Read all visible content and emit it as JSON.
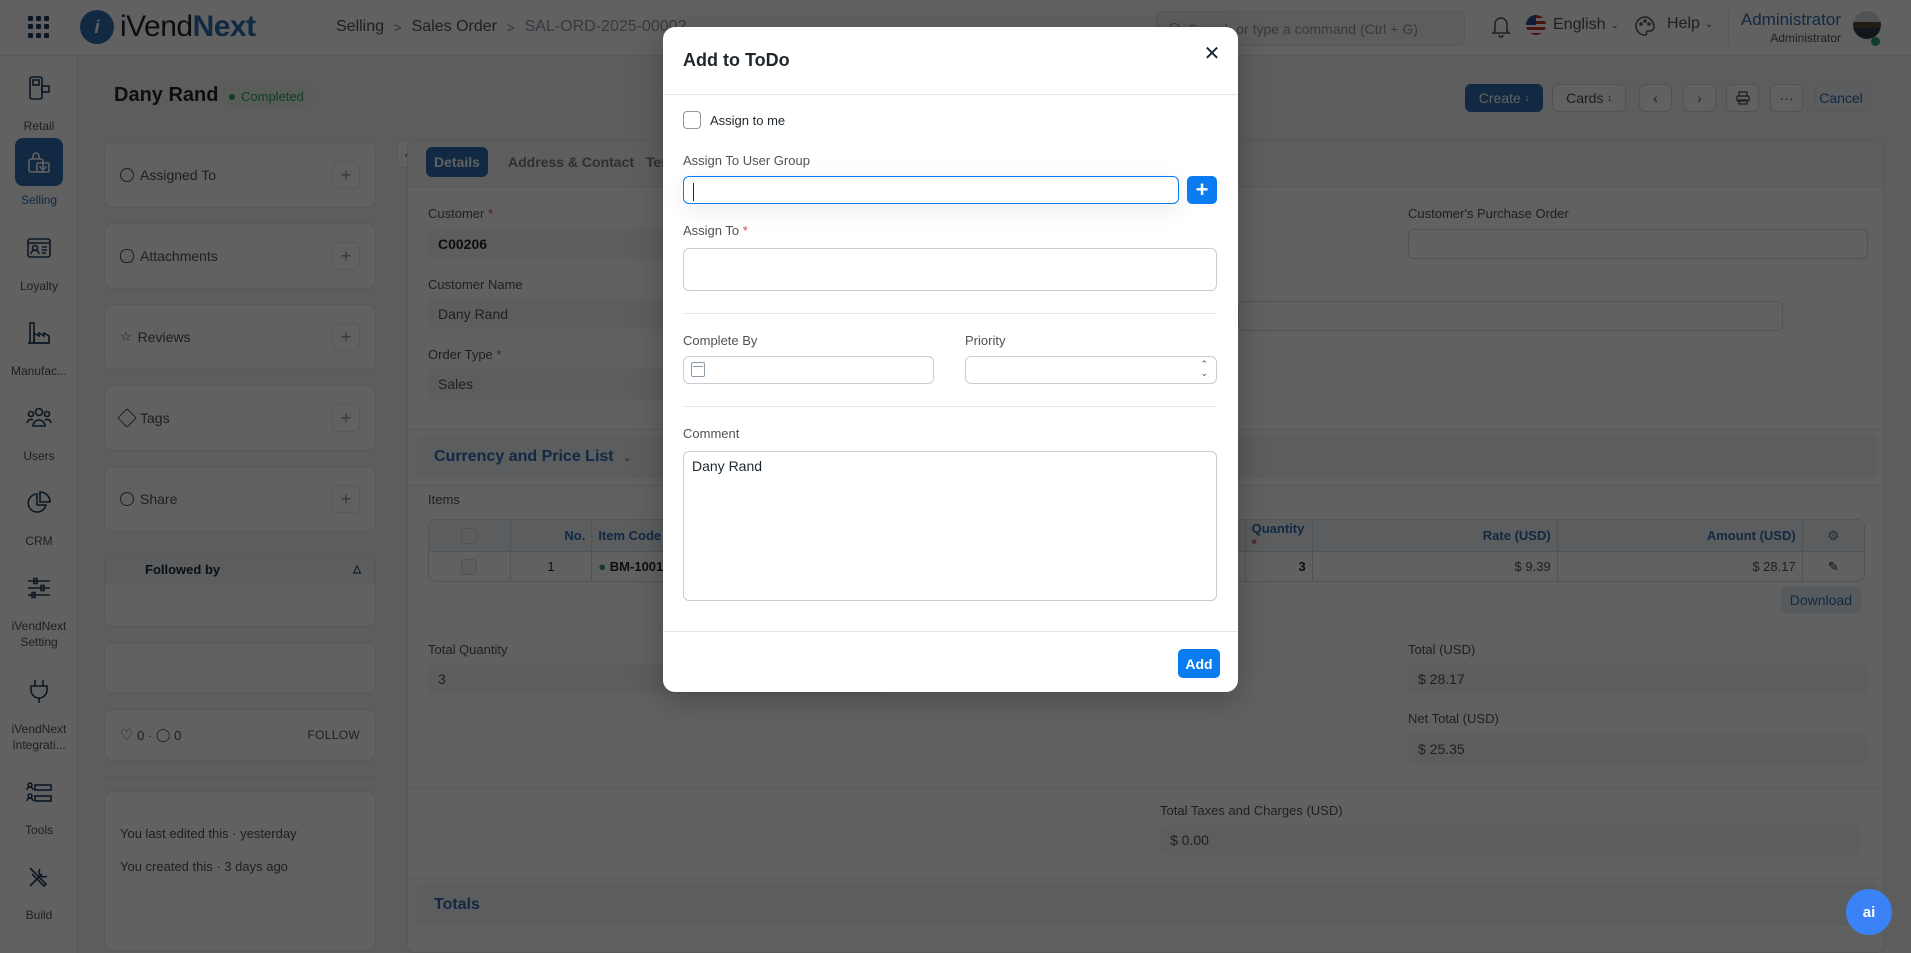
{
  "topbar": {
    "brand_prefix": "iVend",
    "brand_suffix": "Next",
    "breadcrumb": [
      "Selling",
      "Sales Order",
      "SAL-ORD-2025-00002"
    ],
    "search_placeholder": "Search or type a command (Ctrl + G)",
    "language": "English",
    "help_label": "Help",
    "user_name": "Administrator",
    "user_role": "Administrator"
  },
  "rail": {
    "items": [
      {
        "label": "Retail",
        "icon": "pos-terminal-icon"
      },
      {
        "label": "Selling",
        "icon": "shopping-bag-icon",
        "active": true
      },
      {
        "label": "Loyalty",
        "icon": "id-card-icon"
      },
      {
        "label": "Manufac...",
        "icon": "factory-icon"
      },
      {
        "label": "Users",
        "icon": "users-icon"
      },
      {
        "label": "CRM",
        "icon": "pie-chart-icon"
      },
      {
        "label": "iVendNext Setting",
        "icon": "sliders-icon"
      },
      {
        "label": "iVendNext Integrati...",
        "icon": "plug-icon"
      },
      {
        "label": "Tools",
        "icon": "tools-list-icon"
      },
      {
        "label": "Build",
        "icon": "wrench-screwdriver-icon"
      }
    ]
  },
  "header": {
    "title": "Dany Rand",
    "status": "Completed",
    "create_label": "Create",
    "cards_label": "Cards",
    "cancel_label": "Cancel",
    "more_label": "···"
  },
  "sidebar": {
    "cards": [
      {
        "label": "Assigned To"
      },
      {
        "label": "Attachments"
      },
      {
        "label": "Reviews"
      },
      {
        "label": "Tags"
      },
      {
        "label": "Share"
      }
    ],
    "followed_by": "Followed by",
    "likes": "0",
    "comments": "0",
    "follow_label": "FOLLOW",
    "activity": [
      "You last edited this · yesterday",
      "You created this · 3 days ago"
    ]
  },
  "form": {
    "tabs": [
      "Details",
      "Address & Contact",
      "Terms"
    ],
    "customer_label": "Customer",
    "customer_value": "C00206",
    "customer_name_label": "Customer Name",
    "customer_name_value": "Dany Rand",
    "order_type_label": "Order Type",
    "order_type_value": "Sales",
    "purchase_order_label": "Customer's Purchase Order",
    "currency_section": "Currency and Price List",
    "items_label": "Items",
    "items_columns": [
      "No.",
      "Item Code",
      "Quantity",
      "Rate (USD)",
      "Amount (USD)"
    ],
    "items_rows": [
      {
        "no": "1",
        "item_code": "BM-1001",
        "quantity": "3",
        "rate": "$ 9.39",
        "amount": "$ 28.17"
      }
    ],
    "download_label": "Download",
    "total_quantity_label": "Total Quantity",
    "total_quantity_value": "3",
    "total_label": "Total (USD)",
    "total_value": "$ 28.17",
    "net_total_label": "Net Total (USD)",
    "net_total_value": "$ 25.35",
    "taxes_label": "Total Taxes and Charges (USD)",
    "taxes_value": "$ 0.00",
    "totals_section": "Totals"
  },
  "modal": {
    "title": "Add to ToDo",
    "assign_to_me_label": "Assign to me",
    "assign_to_me_checked": false,
    "user_group_label": "Assign To User Group",
    "user_group_value": "",
    "assign_to_label": "Assign To",
    "assign_to_value": "",
    "complete_by_label": "Complete By",
    "complete_by_value": "",
    "priority_label": "Priority",
    "priority_value": "",
    "comment_label": "Comment",
    "comment_value": "Dany Rand",
    "add_label": "Add"
  },
  "ai_button_label": "ai",
  "colors": {
    "brand": "#2f6db1",
    "primary_action": "#0a7cf0",
    "status_completed": "#2e9e6a",
    "required": "#e24c4c"
  }
}
